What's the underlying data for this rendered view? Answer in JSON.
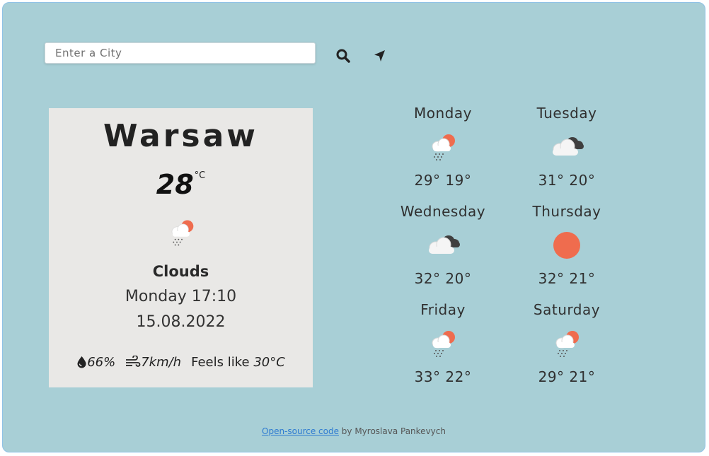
{
  "search": {
    "placeholder": "Enter a City",
    "value": ""
  },
  "current": {
    "city": "Warsaw",
    "temperature": "28",
    "unit": "°C",
    "condition": "Clouds",
    "day_time": "Monday 17:10",
    "date": "15.08.2022",
    "humidity": "66%",
    "wind": "7km/h",
    "feels_like_label": "Feels like",
    "feels_like_value": "30°C",
    "icon": "cloud-rain-sun-icon"
  },
  "forecast": [
    {
      "day": "Monday",
      "temps": "29° 19°",
      "icon": "cloud-rain-sun-icon"
    },
    {
      "day": "Tuesday",
      "temps": "31° 20°",
      "icon": "broken-clouds-icon"
    },
    {
      "day": "Wednesday",
      "temps": "32° 20°",
      "icon": "broken-clouds-icon"
    },
    {
      "day": "Thursday",
      "temps": "32° 21°",
      "icon": "sun-icon"
    },
    {
      "day": "Friday",
      "temps": "33° 22°",
      "icon": "cloud-rain-sun-icon"
    },
    {
      "day": "Saturday",
      "temps": "29° 21°",
      "icon": "cloud-rain-sun-icon"
    }
  ],
  "footer": {
    "link_text": "Open-source code",
    "by_text": " by Myroslava Pankevych"
  },
  "colors": {
    "background": "#a8cfd6",
    "card": "#e9e8e6",
    "sun": "#ef6c4e",
    "link": "#2e7bd1"
  }
}
